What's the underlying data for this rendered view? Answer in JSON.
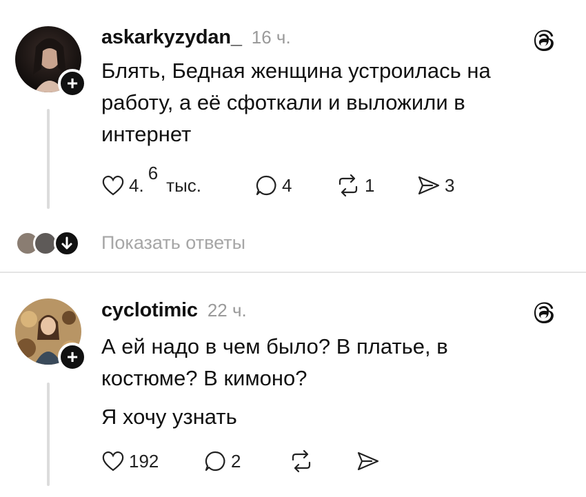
{
  "posts": [
    {
      "username": "askarkyzydan_",
      "time": "16 ч.",
      "text_lines": [
        "Блять, Бедная женщина устроилась на",
        "работу, а её сфоткали и выложили в",
        "интернет"
      ],
      "likes": "4.",
      "likes_sup": "6",
      "likes_unit": "тыс.",
      "replies": "4",
      "reposts": "1",
      "shares": "3",
      "avatar_icon": "user-avatar-woman-photo",
      "show_replies": "Показать ответы"
    },
    {
      "username": "cyclotimic",
      "time": "22 ч.",
      "text_lines": [
        "А ей надо в чем было? В платье, в",
        "костюме? В кимоно?"
      ],
      "text_line2": "Я хочу узнать",
      "likes": "192",
      "replies": "2",
      "avatar_icon": "user-avatar-illustration"
    }
  ],
  "colors": {
    "accent": "#111111",
    "muted": "#9a9a9a",
    "divider": "#e4e4e4"
  }
}
